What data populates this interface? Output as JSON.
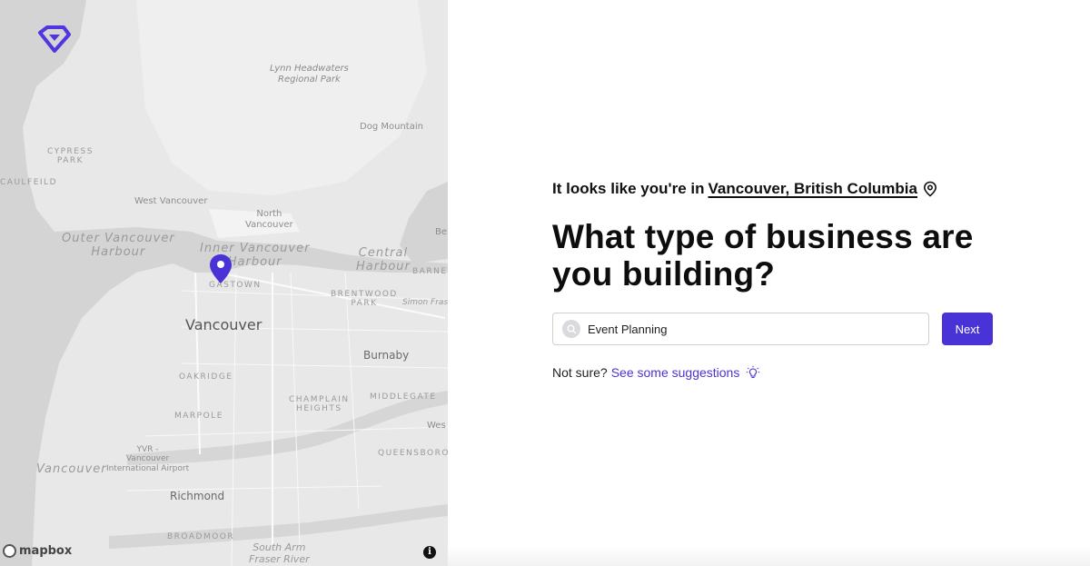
{
  "map": {
    "labels": {
      "lynn": "Lynn Headwaters\nRegional Park",
      "dog_mountain": "Dog Mountain",
      "cypress": "CYPRESS\nPARK",
      "caulfeild": "CAULFEILD",
      "west_vancouver": "West Vancouver",
      "north_vancouver": "North\nVancouver",
      "outer_harbour": "Outer Vancouver\nHarbour",
      "inner_harbour": "Inner Vancouver\nHarbour",
      "central_harbour": "Central\nHarbour",
      "barnet": "BARNET",
      "belcarra": "Bel",
      "gastown": "GASTOWN",
      "brentwood": "BRENTWOOD\nPARK",
      "simon_fraser": "Simon Frase",
      "vancouver": "Vancouver",
      "burnaby": "Burnaby",
      "oakridge": "OAKRIDGE",
      "champlain": "CHAMPLAIN\nHEIGHTS",
      "middlegate": "MIDDLEGATE",
      "marpole": "MARPOLE",
      "west_edge": "Wes",
      "queensborough": "QUEENSBOROUGH",
      "yvr": "YVR -\nVancouver\nInternational Airport",
      "vancouver_sea": "Vancouver",
      "richmond": "Richmond",
      "broadmoor": "BROADMOOR",
      "south_arm": "South Arm\nFraser River"
    },
    "attribution": "mapbox",
    "info_glyph": "i"
  },
  "location": {
    "prefix": "It looks like you're in",
    "place": "Vancouver, British Columbia"
  },
  "headline": "What type of business are you building?",
  "search": {
    "value": "Event Planning",
    "placeholder": ""
  },
  "next_label": "Next",
  "suggest": {
    "prefix": "Not sure?",
    "link": "See some suggestions"
  },
  "colors": {
    "accent": "#4a33d6",
    "map_land": "#e9e9e9",
    "map_water": "#d2d2d2"
  }
}
